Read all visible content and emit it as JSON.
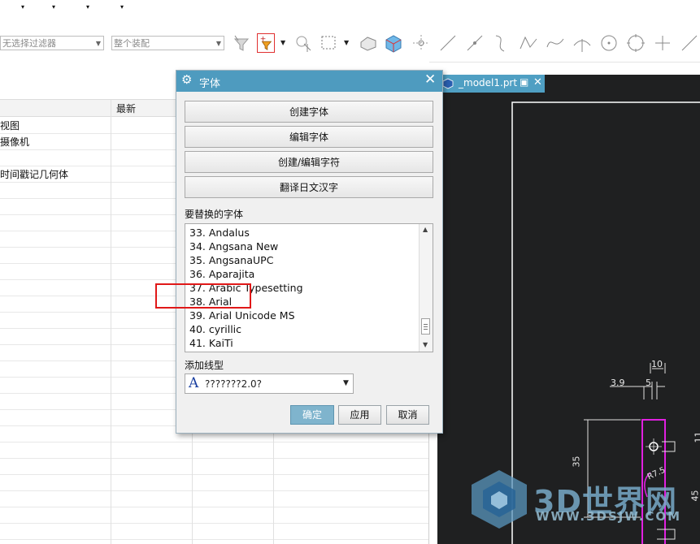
{
  "menubar": {
    "arrows": [
      "▾",
      "▾",
      "▾",
      "▾"
    ]
  },
  "toolbar": {
    "filter_combo": "无选择过滤器",
    "assembly_combo": "整个装配"
  },
  "navigator": {
    "column_latest": "最新",
    "rows": [
      "视图",
      "摄像机",
      "",
      "时间戳记几何体"
    ]
  },
  "graphics": {
    "tab_title": "_model1.prt",
    "dims": {
      "d10": "10",
      "d39": "3.9",
      "d5": "5",
      "d35": "35",
      "d45": "45",
      "d11": "11",
      "dr75": "R7.5"
    }
  },
  "dialog": {
    "title": "字体",
    "buttons": [
      "创建字体",
      "编辑字体",
      "创建/编辑字符",
      "翻译日文汉字"
    ],
    "replace_label": "要替换的字体",
    "fonts": [
      "33. Andalus",
      "34. Angsana New",
      "35. AngsanaUPC",
      "36. Aparajita",
      "37. Arabic Typesetting",
      "38. Arial",
      "39. Arial Unicode MS",
      "40. cyrillic",
      "41. KaiTi"
    ],
    "linetype_label": "添加线型",
    "linetype_value": "???????2.0?",
    "linetype_glyph": "A",
    "ok": "确定",
    "apply": "应用",
    "cancel": "取消"
  },
  "watermark": {
    "brand": "3D世界网",
    "url": "WWW.3DSJW.COM"
  },
  "colors": {
    "title_bar": "#4e9bbf",
    "ok_button": "#7fb4cd",
    "highlight_box": "#e01818",
    "graphics_bg": "#1f2021",
    "magenta": "#e020e0"
  }
}
